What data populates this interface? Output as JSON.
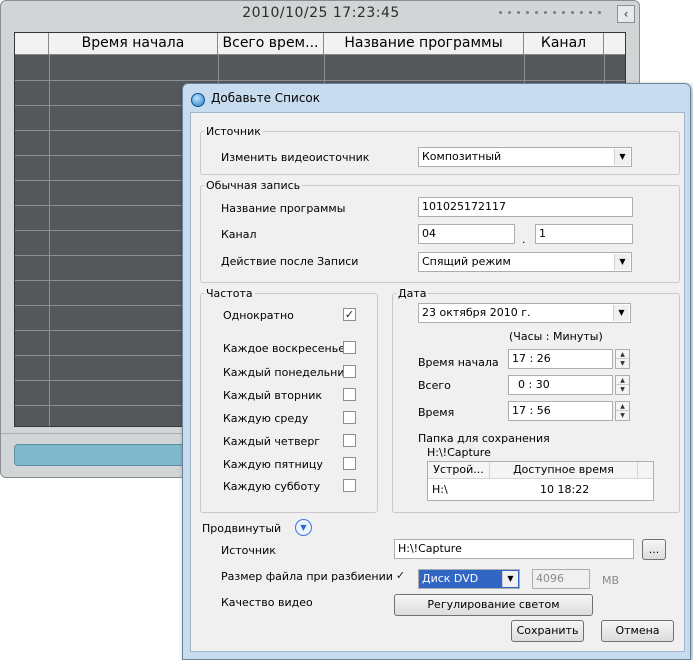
{
  "background_window": {
    "title": "2010/10/25 17:23:45",
    "minimize_glyph": "‹",
    "columns": [
      "Время начала",
      "Всего врем...",
      "Название программы",
      "Канал"
    ]
  },
  "dialog": {
    "title": "Добавьте Список",
    "source": {
      "legend": "Источник",
      "change_label": "Изменить видеоисточник",
      "change_value": "Композитный"
    },
    "normal": {
      "legend": "Обычная запись",
      "program_label": "Название программы",
      "program_value": "101025172117",
      "channel_label": "Канал",
      "channel_major": "04",
      "channel_sep": ".",
      "channel_minor": "1",
      "after_label": "Действие после Записи",
      "after_value": "Спящий режим"
    },
    "frequency": {
      "legend": "Частота",
      "items": [
        {
          "label": "Однократно",
          "checked": true
        },
        {
          "label": "Каждое воскресенье",
          "checked": false
        },
        {
          "label": "Каждый понедельник",
          "checked": false
        },
        {
          "label": "Каждый вторник",
          "checked": false
        },
        {
          "label": "Каждую среду",
          "checked": false
        },
        {
          "label": "Каждый четверг",
          "checked": false
        },
        {
          "label": "Каждую пятницу",
          "checked": false
        },
        {
          "label": "Каждую субботу",
          "checked": false
        }
      ]
    },
    "date": {
      "legend": "Дата",
      "date_value": "23  октября  2010 г.",
      "hours_hint": "(Часы : Минуты)",
      "start_label": "Время начала",
      "start_value": "17 : 26",
      "total_label": "Всего",
      "total_value": "0 : 30",
      "time_label": "Время",
      "time_value": "17 : 56",
      "folder_label": "Папка для сохранения",
      "folder_path": "H:\\!Capture",
      "table": {
        "columns": [
          "Устрой...",
          "Доступное время"
        ],
        "rows": [
          [
            "H:\\",
            "10  18:22"
          ]
        ]
      }
    },
    "advanced": {
      "label": "Продвинутый",
      "source_label": "Источник",
      "source_value": "H:\\!Capture",
      "browse_label": "...",
      "split_label": "Размер файла при разбиении",
      "split_checked": true,
      "split_media": "Диск DVD",
      "split_size": "4096",
      "split_unit": "MB",
      "quality_label": "Качество видео",
      "quality_button": "Регулирование светом"
    },
    "save_button": "Сохранить",
    "cancel_button": "Отмена"
  }
}
